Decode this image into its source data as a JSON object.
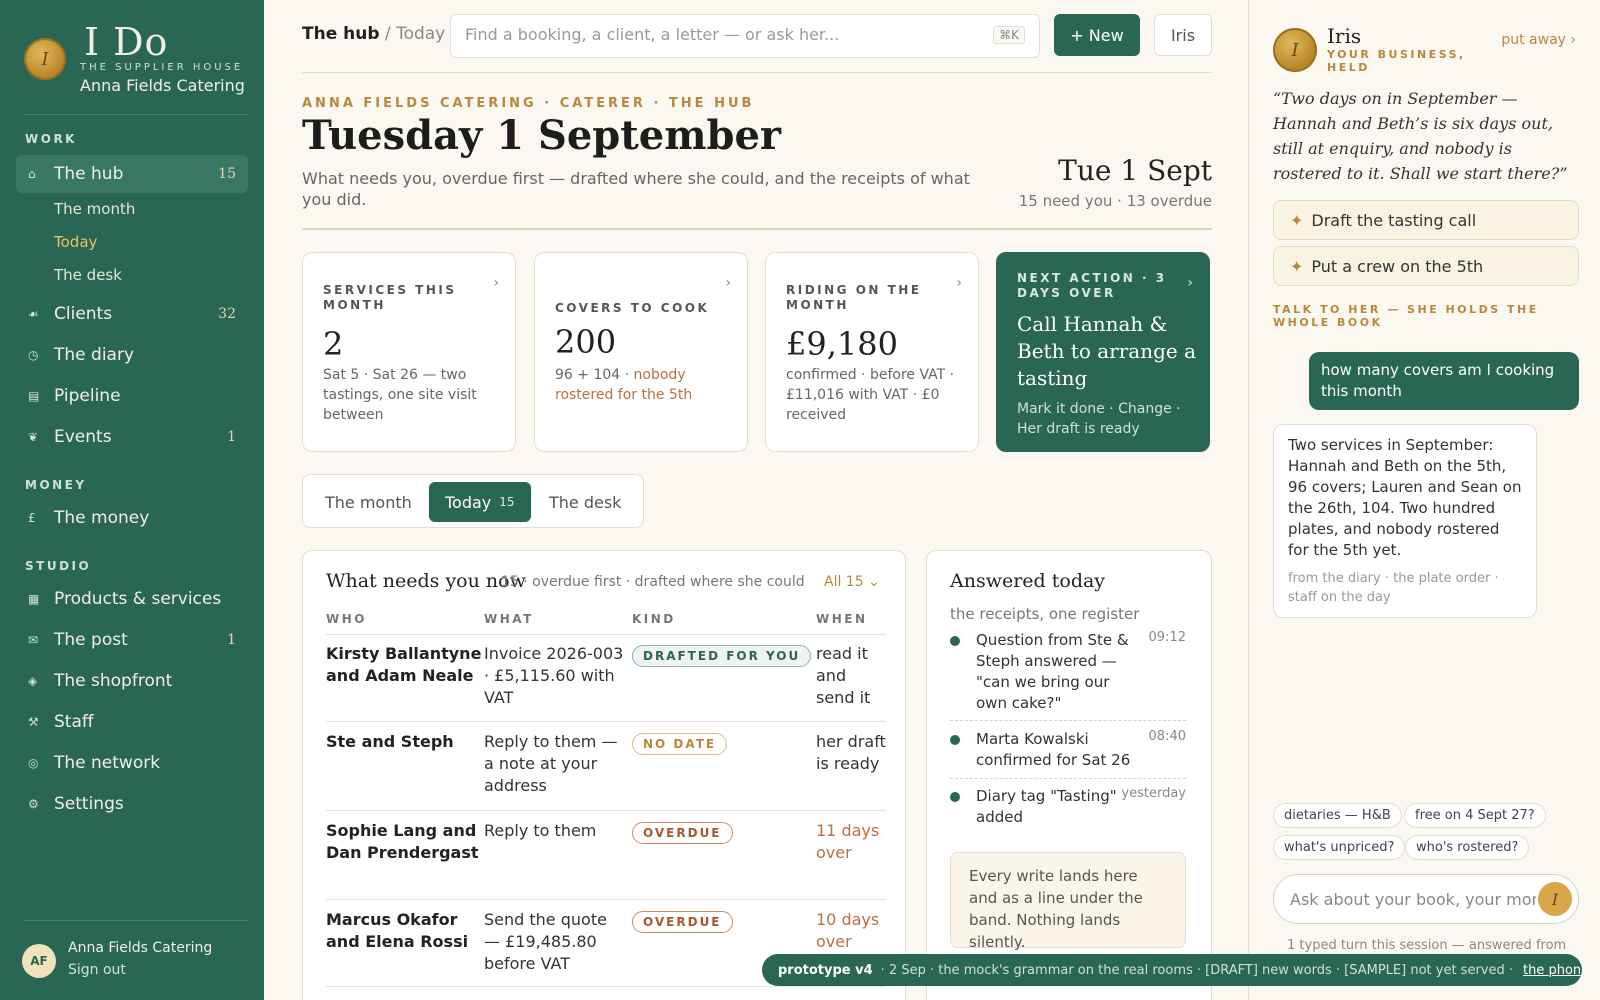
{
  "brand": {
    "mark": "I Do",
    "seal_letter": "I",
    "subtitle": "THE SUPPLIER HOUSE",
    "business": "Anna Fields Catering"
  },
  "sidebar": {
    "work_label": "WORK",
    "hub": {
      "label": "The hub",
      "count": "15"
    },
    "hub_sub": [
      "The month",
      "Today",
      "The desk"
    ],
    "clients": {
      "label": "Clients",
      "count": "32"
    },
    "diary": {
      "label": "The diary"
    },
    "pipeline": {
      "label": "Pipeline"
    },
    "events": {
      "label": "Events",
      "count": "1"
    },
    "money_label": "MONEY",
    "money": {
      "label": "The money"
    },
    "studio_label": "STUDIO",
    "products": {
      "label": "Products & services"
    },
    "post": {
      "label": "The post",
      "count": "1"
    },
    "shopfront": {
      "label": "The shopfront"
    },
    "staff": {
      "label": "Staff"
    },
    "network": {
      "label": "The network"
    },
    "settings": {
      "label": "Settings"
    },
    "foot": {
      "initials": "AF",
      "name": "Anna Fields Catering",
      "signout": "Sign out"
    }
  },
  "header": {
    "crumb_main": "The hub",
    "crumb_sep": " / ",
    "crumb_sub": "Today",
    "search_placeholder": "Find a booking, a client, a letter — or ask her...",
    "search_kbd": "⌘K",
    "new_label": "+ New",
    "iris_label": "Iris"
  },
  "hero": {
    "eyebrow": "ANNA FIELDS CATERING · CATERER · THE HUB",
    "title": "Tuesday 1 September",
    "subtitle": "What needs you, overdue first — drafted where she could, and the receipts of what you did.",
    "date": "Tue 1 Sept",
    "date_summary": "15 need you · 13 overdue"
  },
  "stats": [
    {
      "label": "SERVICES THIS MONTH",
      "value": "2",
      "desc": "Sat 5 · Sat 26 — two tastings, one site visit between"
    },
    {
      "label": "COVERS TO COOK",
      "value": "200",
      "desc_a": "96 + 104 · ",
      "desc_b": "nobody rostered for the 5th"
    },
    {
      "label": "RIDING ON THE MONTH",
      "value": "£9,180",
      "desc": "confirmed · before VAT · £11,016 with VAT · £0 received"
    },
    {
      "label": "NEXT ACTION · 3 DAYS OVER",
      "action": "Call Hannah & Beth to arrange a tasting",
      "desc": "Mark it done · Change · Her draft is ready"
    }
  ],
  "segments": {
    "month": "The month",
    "today": "Today",
    "today_count": "15",
    "desk": "The desk"
  },
  "needs": {
    "title": "What needs you now",
    "meta": "15 · overdue first · drafted where she could",
    "filter": "All 15 ⌄",
    "headers": [
      "WHO",
      "WHAT",
      "KIND",
      "WHEN"
    ],
    "rows": [
      {
        "who": "Kirsty Ballantyne and Adam Neale",
        "what": "Invoice 2026-003 · £5,115.60 with VAT",
        "kind": "DRAFTED FOR YOU",
        "when": "read it and send it"
      },
      {
        "who": "Ste and Steph",
        "what": "Reply to them — a note at your address",
        "kind": "NO DATE",
        "when": "her draft is ready"
      },
      {
        "who": "Sophie Lang and Dan Prendergast",
        "what": "Reply to them",
        "kind": "OVERDUE",
        "when": "11 days over"
      },
      {
        "who": "Marcus Okafor and Elena Rossi",
        "what": "Send the quote — £19,485.80 before VAT",
        "kind": "OVERDUE",
        "when": "10 days over"
      }
    ]
  },
  "answered": {
    "title": "Answered today",
    "subtitle": "the receipts, one register",
    "items": [
      {
        "text": "Question from Ste & Steph answered — \"can we bring our own cake?\"",
        "time": "09:12"
      },
      {
        "text": "Marta Kowalski confirmed for Sat 26",
        "time": "08:40"
      },
      {
        "text": "Diary tag \"Tasting\" added",
        "time": "yesterday"
      }
    ],
    "note": "Every write lands here and as a line under the band. Nothing lands silently."
  },
  "iris": {
    "seal_letter": "I",
    "name": "Iris",
    "tagline": "YOUR BUSINESS, HELD",
    "away": "put away ›",
    "quote": "“Two days on in September — Hannah and Beth’s is six days out, still at enquiry, and nobody is rostered to it. Shall we start there?”",
    "action1": "Draft the tasting call",
    "action2": "Put a crew on the 5th",
    "talk_label": "TALK TO HER — SHE HOLDS THE WHOLE BOOK",
    "me": "how many covers am I cooking this month",
    "her": "Two services in September: Hannah and Beth on the 5th, 96 covers; Lauren and Sean on the 26th, 104. Two hundred plates, and nobody rostered for the 5th yet.",
    "her_src": "from the diary · the plate order · staff on the day",
    "chips": [
      "dietaries — H&B",
      "free on 4 Sept 27?",
      "what's unpriced?",
      "who's rostered?"
    ],
    "ask_placeholder": "Ask about your book, your month",
    "foot": "1 typed turn this session — answered from"
  },
  "banner": {
    "tag": "prototype v4",
    "text": "· 2 Sep · the mock's grammar on the real rooms · [DRAFT] new words · [SAMPLE] not yet served ·",
    "link": "the phone ›"
  },
  "colors": {
    "brand_green": "#2a6654",
    "gold": "#b9883a",
    "overdue": "#a8582c",
    "paper": "#fbf8f1"
  }
}
